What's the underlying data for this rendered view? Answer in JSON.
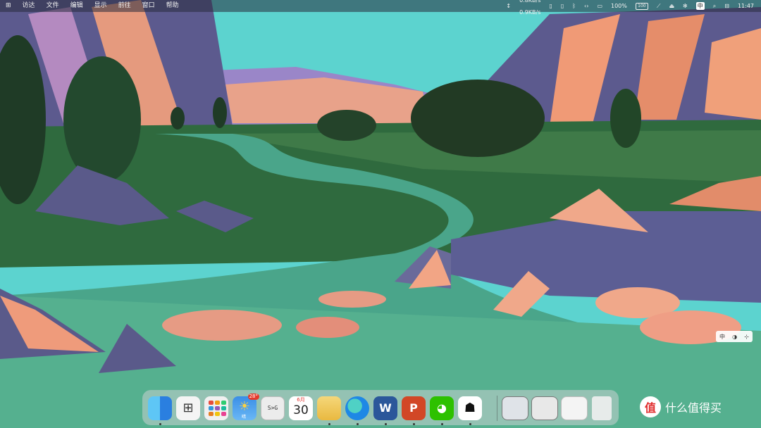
{
  "menubar": {
    "windows_logo": "windows-icon",
    "menus": [
      "访达",
      "文件",
      "编辑",
      "显示",
      "前往",
      "窗口",
      "帮助"
    ],
    "net_up": "0.8KB/s",
    "net_down": "0.9KB/s",
    "battery_percent": "100%",
    "battery_level": "100",
    "ime": "中",
    "time": "11:47"
  },
  "dock": {
    "apps": [
      {
        "name": "Finder",
        "icon": "finder-icon"
      },
      {
        "name": "Windows Start",
        "icon": "windows-icon"
      },
      {
        "name": "Launchpad",
        "icon": "launchpad-icon"
      },
      {
        "name": "Weather",
        "icon": "weather-icon",
        "badge": "28°",
        "sub": "晴"
      },
      {
        "name": "Terminal",
        "icon": "terminal-icon",
        "text": "S>G"
      },
      {
        "name": "Calendar",
        "icon": "calendar-icon",
        "month": "6月",
        "day": "30"
      },
      {
        "name": "Folder",
        "icon": "folder-icon"
      },
      {
        "name": "Edge",
        "icon": "edge-icon"
      },
      {
        "name": "Word",
        "icon": "word-icon",
        "letter": "W"
      },
      {
        "name": "PowerPoint",
        "icon": "powerpoint-icon",
        "letter": "P"
      },
      {
        "name": "WeChat",
        "icon": "wechat-icon"
      },
      {
        "name": "QQ",
        "icon": "qq-icon"
      }
    ],
    "trash": "trash-icon"
  },
  "ime_float": [
    "中",
    "◑",
    "⊹"
  ],
  "watermark": {
    "logo": "值",
    "text": "什么值得买"
  },
  "colors": {
    "sky": "#5cd3cf",
    "water": "#4aa58a",
    "grass": "#2f6a3e",
    "rock": "#5a5a8a",
    "peach": "#f0a07a"
  }
}
